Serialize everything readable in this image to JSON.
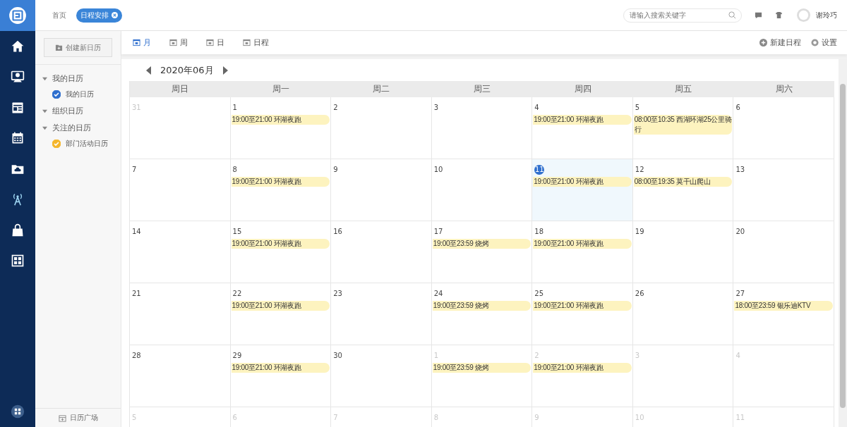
{
  "nav": {
    "items": [
      {
        "kind": "home"
      },
      {
        "kind": "person"
      },
      {
        "kind": "news"
      },
      {
        "kind": "calendar"
      },
      {
        "kind": "folder"
      },
      {
        "kind": "antenna"
      },
      {
        "kind": "bag"
      },
      {
        "kind": "grid"
      }
    ]
  },
  "top_bar": {
    "tabs": [
      {
        "label": "首页",
        "selected": false,
        "closable": false
      },
      {
        "label": "日程安排",
        "selected": true,
        "closable": true
      }
    ],
    "search": {
      "placeholder": "请输入搜索关键字"
    },
    "user": {
      "name": "谢玲巧"
    }
  },
  "sidebar": {
    "create_button": "创建新日历",
    "groups": [
      {
        "label": "我的日历",
        "expanded": true,
        "children": [
          {
            "label": "我的日历",
            "checked": true,
            "color": "#2f6fce"
          }
        ]
      },
      {
        "label": "组织日历",
        "expanded": true
      },
      {
        "label": "关注的日历",
        "expanded": true,
        "children": [
          {
            "label": "部门活动日历",
            "checked": true,
            "color": "#f4b62c"
          }
        ]
      }
    ],
    "footer_button": "日历广场"
  },
  "toolbar": {
    "views": [
      {
        "label": "月",
        "selected": true
      },
      {
        "label": "周",
        "selected": false
      },
      {
        "label": "日",
        "selected": false
      },
      {
        "label": "日程",
        "selected": false
      }
    ],
    "actions": [
      {
        "kind": "add",
        "label": "新建日程"
      },
      {
        "kind": "settings",
        "label": "设置"
      }
    ]
  },
  "calendar": {
    "title": "2020年06月",
    "weekdays": [
      "周日",
      "周一",
      "周二",
      "周三",
      "周四",
      "周五",
      "周六"
    ],
    "weeks": [
      [
        {
          "day": "31",
          "other_month": true,
          "today": false
        },
        {
          "day": "1",
          "other_month": false,
          "today": false,
          "events": [
            "19:00至21:00 环湖夜跑"
          ]
        },
        {
          "day": "2",
          "other_month": false,
          "today": false
        },
        {
          "day": "3",
          "other_month": false,
          "today": false
        },
        {
          "day": "4",
          "other_month": false,
          "today": false,
          "events": [
            "19:00至21:00 环湖夜跑"
          ]
        },
        {
          "day": "5",
          "other_month": false,
          "today": false,
          "events": [
            "08:00至10:35 西湖环湖25公里骑行"
          ]
        },
        {
          "day": "6",
          "other_month": false,
          "today": false
        }
      ],
      [
        {
          "day": "7",
          "other_month": false,
          "today": false
        },
        {
          "day": "8",
          "other_month": false,
          "today": false,
          "events": [
            "19:00至21:00 环湖夜跑"
          ]
        },
        {
          "day": "9",
          "other_month": false,
          "today": false
        },
        {
          "day": "10",
          "other_month": false,
          "today": false
        },
        {
          "day": "11",
          "other_month": false,
          "today": true,
          "events": [
            "19:00至21:00 环湖夜跑"
          ]
        },
        {
          "day": "12",
          "other_month": false,
          "today": false,
          "events": [
            "08:00至19:35 莫干山爬山"
          ]
        },
        {
          "day": "13",
          "other_month": false,
          "today": false
        }
      ],
      [
        {
          "day": "14",
          "other_month": false,
          "today": false
        },
        {
          "day": "15",
          "other_month": false,
          "today": false,
          "events": [
            "19:00至21:00 环湖夜跑"
          ]
        },
        {
          "day": "16",
          "other_month": false,
          "today": false
        },
        {
          "day": "17",
          "other_month": false,
          "today": false,
          "events": [
            "19:00至23:59 烧烤"
          ]
        },
        {
          "day": "18",
          "other_month": false,
          "today": false,
          "events": [
            "19:00至21:00 环湖夜跑"
          ]
        },
        {
          "day": "19",
          "other_month": false,
          "today": false
        },
        {
          "day": "20",
          "other_month": false,
          "today": false
        }
      ],
      [
        {
          "day": "21",
          "other_month": false,
          "today": false
        },
        {
          "day": "22",
          "other_month": false,
          "today": false,
          "events": [
            "19:00至21:00 环湖夜跑"
          ]
        },
        {
          "day": "23",
          "other_month": false,
          "today": false
        },
        {
          "day": "24",
          "other_month": false,
          "today": false,
          "events": [
            "19:00至23:59 烧烤"
          ]
        },
        {
          "day": "25",
          "other_month": false,
          "today": false,
          "events": [
            "19:00至21:00 环湖夜跑"
          ]
        },
        {
          "day": "26",
          "other_month": false,
          "today": false
        },
        {
          "day": "27",
          "other_month": false,
          "today": false,
          "events": [
            "18:00至23:59 银乐迪KTV"
          ]
        }
      ],
      [
        {
          "day": "28",
          "other_month": false,
          "today": false
        },
        {
          "day": "29",
          "other_month": false,
          "today": false,
          "events": [
            "19:00至21:00 环湖夜跑"
          ]
        },
        {
          "day": "30",
          "other_month": false,
          "today": false
        },
        {
          "day": "1",
          "other_month": true,
          "today": false,
          "events": [
            "19:00至23:59 烧烤"
          ]
        },
        {
          "day": "2",
          "other_month": true,
          "today": false,
          "events": [
            "19:00至21:00 环湖夜跑"
          ]
        },
        {
          "day": "3",
          "other_month": true,
          "today": false
        },
        {
          "day": "4",
          "other_month": true,
          "today": false
        }
      ],
      [
        {
          "day": "5",
          "other_month": true,
          "today": false
        },
        {
          "day": "6",
          "other_month": true,
          "today": false
        },
        {
          "day": "7",
          "other_month": true,
          "today": false
        },
        {
          "day": "8",
          "other_month": true,
          "today": false
        },
        {
          "day": "9",
          "other_month": true,
          "today": false
        },
        {
          "day": "10",
          "other_month": true,
          "today": false
        },
        {
          "day": "11",
          "other_month": true,
          "today": false
        }
      ]
    ]
  }
}
